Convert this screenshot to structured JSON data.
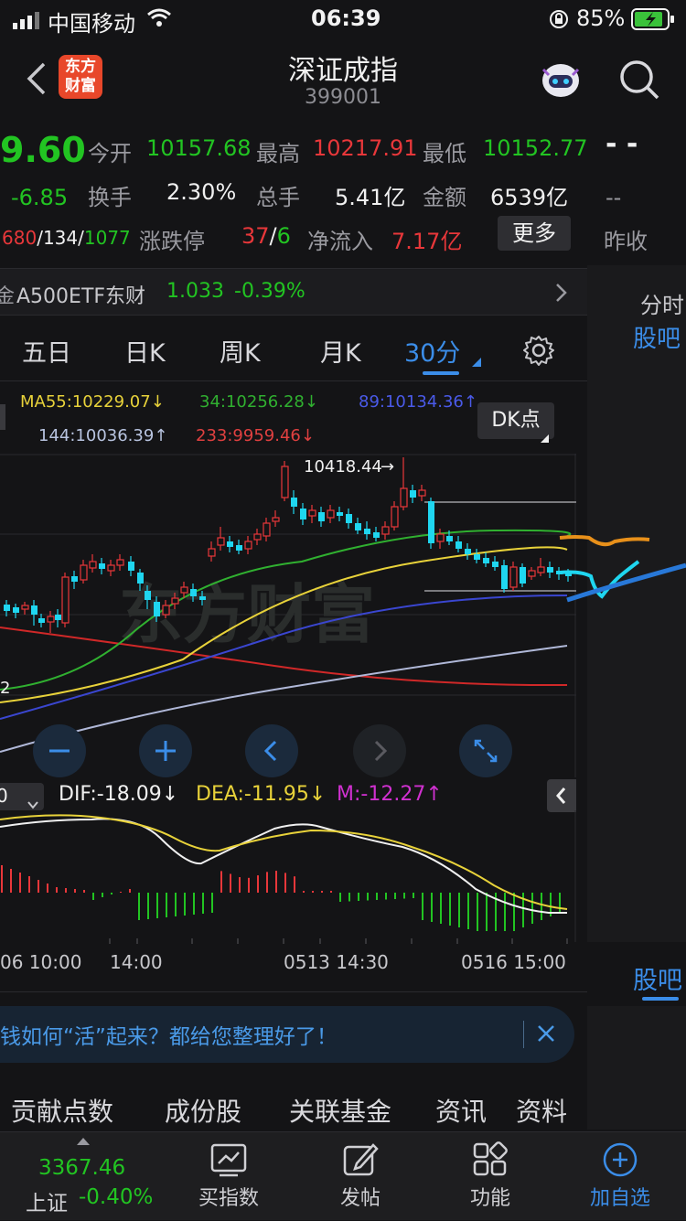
{
  "status": {
    "carrier": "中国移动",
    "time": "06:39",
    "battery": "85%"
  },
  "header": {
    "title": "深证成指",
    "code": "399001",
    "logo_line1": "东方",
    "logo_line2": "财富"
  },
  "quote": {
    "price": "9.60",
    "change": "-6.85",
    "open_label": "今开",
    "open": "10157.68",
    "high_label": "最高",
    "high": "10217.91",
    "low_label": "最低",
    "low": "10152.77",
    "turnover_label": "换手",
    "turnover": "2.30%",
    "volume_label": "总手",
    "volume": "5.41亿",
    "amount_label": "金额",
    "amount": "6539亿",
    "updown_up": "680",
    "updown_flat": "134",
    "updown_down": "1077",
    "limit_label": "涨跌停",
    "limit_up": "37",
    "limit_down": "6",
    "inflow_label": "净流入",
    "inflow": "7.17亿",
    "more_label": "更多",
    "side_dash1": "- -",
    "side_dash2": "--",
    "side_prev_label": "昨收"
  },
  "etf": {
    "prefix": "金",
    "name": "A500ETF东财",
    "price": "1.033",
    "change": "-0.39%"
  },
  "right_panel": {
    "tab_label": "分时",
    "guba_label": "股吧"
  },
  "tabs": {
    "five_day": "五日",
    "day_k": "日K",
    "week_k": "周K",
    "month_k": "月K",
    "min30": "30分"
  },
  "ma_legend": {
    "ma55": "MA55:10229.07",
    "ma34": "34:10256.28",
    "ma89": "89:10134.36",
    "ma144": "144:10036.39",
    "ma233": "233:9959.46",
    "dk_label": "DK点"
  },
  "chart": {
    "peak_label": "10418.44",
    "left_edge_label": "2",
    "watermark": "东方财富"
  },
  "macd": {
    "period": "0",
    "dif": "DIF:-18.09",
    "dea": "DEA:-11.95",
    "m": "M:-12.27"
  },
  "timeaxis": {
    "t1": "06 10:00",
    "t2": "14:00",
    "t3": "0513 14:30",
    "t4": "0516 15:00"
  },
  "promo": {
    "text": "钱如何“活”起来？都给您整理好了！"
  },
  "subtabs": {
    "s1": "贡献点数",
    "s2": "成份股",
    "s3": "关联基金",
    "s4": "资讯",
    "s5": "资料"
  },
  "bottom": {
    "index_value": "3367.46",
    "index_name": "上证",
    "index_change": "-0.40%",
    "buy_index": "买指数",
    "post": "发帖",
    "features": "功能",
    "add_watch": "加自选"
  },
  "colors": {
    "up": "#e8373a",
    "down": "#22c422",
    "accent": "#3b8de8",
    "cyan": "#1fd6f0"
  }
}
